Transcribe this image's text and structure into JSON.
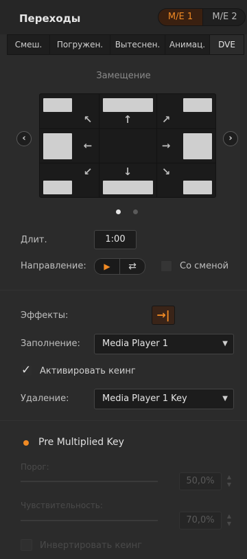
{
  "header": {
    "title": "Переходы",
    "me_tabs": [
      "M/E 1",
      "M/E 2"
    ],
    "me_active": "M/E 1"
  },
  "tabs": [
    {
      "label": "Смеш."
    },
    {
      "label": "Погружен."
    },
    {
      "label": "Вытеснен."
    },
    {
      "label": "Анимац."
    },
    {
      "label": "DVE"
    }
  ],
  "active_tab": "DVE",
  "position": {
    "title": "Замещение",
    "icons": {
      "prev": "chevron-left-icon",
      "next": "chevron-right-icon"
    },
    "page_dots": 2,
    "active_dot": 0
  },
  "duration": {
    "label": "Длит.",
    "value": "1:00"
  },
  "direction": {
    "label": "Направление:",
    "icons": [
      "play-icon",
      "reverse-icon"
    ]
  },
  "flip_flop": {
    "label": "Со сменой",
    "checked": false
  },
  "effects": {
    "label": "Эффекты:",
    "icon": "arrow-to-line-icon"
  },
  "fill": {
    "label": "Заполнение:",
    "value": "Media Player 1"
  },
  "enable_key": {
    "label": "Активировать кеинг",
    "checked": true
  },
  "key_source": {
    "label": "Удаление:",
    "value": "Media Player 1 Key"
  },
  "pre_multiplied": {
    "label": "Pre Multiplied Key",
    "selected": true
  },
  "clip": {
    "label": "Порог:",
    "value": "50,0%",
    "level": 0.5
  },
  "gain": {
    "label": "Чувствительность:",
    "value": "70,0%",
    "level": 0.7
  },
  "invert": {
    "label": "Инвертировать кеинг",
    "checked": false
  },
  "colors": {
    "accent": "#f08a24",
    "background": "#2b2b2b"
  }
}
